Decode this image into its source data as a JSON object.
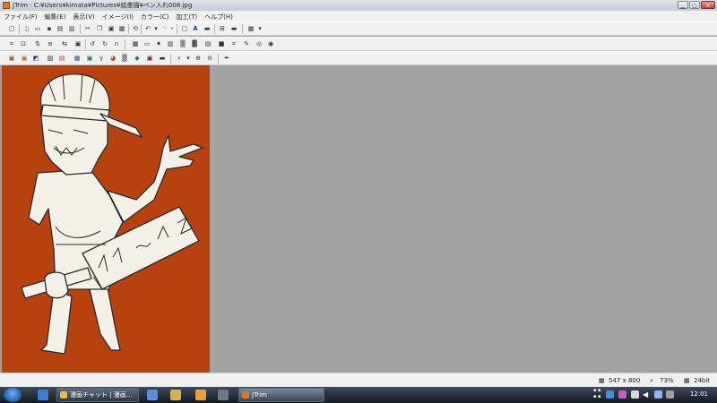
{
  "window": {
    "title": "JTrim  -  C:¥Users¥kimata¥Pictures¥絵墨描¥ペン入れ008.jpg"
  },
  "menu": [
    "ファイル(F)",
    "編集(E)",
    "表示(V)",
    "イメージ(I)",
    "カラー(C)",
    "加工(T)",
    "ヘルプ(H)"
  ],
  "toolbar": {
    "text_tool_label": "A"
  },
  "status": {
    "dimensions": "547 x 800",
    "zoom": "73%",
    "bit_depth": "24bit"
  },
  "taskbar": {
    "tasks": [
      {
        "label": "漫画チャット | 漫画..."
      },
      {
        "label": "JTrim"
      }
    ],
    "clock": "12:01"
  },
  "colors": {
    "canvas_bg": "#a2a2a2",
    "picture_bg": "#b8420f"
  }
}
